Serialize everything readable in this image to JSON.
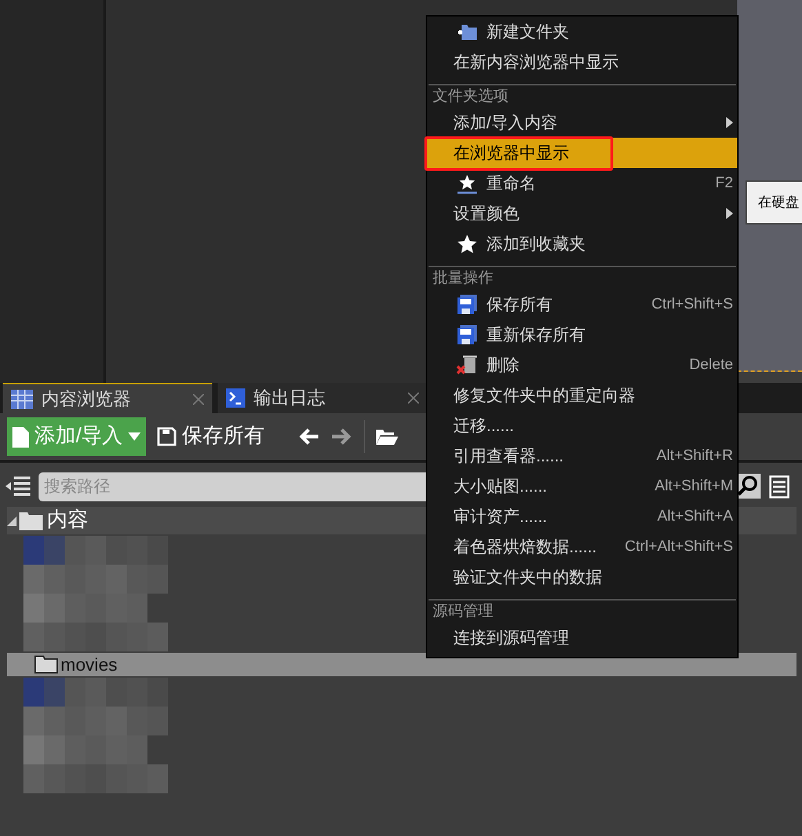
{
  "panel_tabs": [
    {
      "label": "内容浏览器",
      "selected": true
    },
    {
      "label": "输出日志",
      "selected": false
    }
  ],
  "toolbar": {
    "add_button": "添加/导入",
    "save_button": "保存所有"
  },
  "search": {
    "placeholder": "搜索路径"
  },
  "tree": [
    {
      "label": "内容",
      "kind": "root"
    },
    {
      "kind": "blurred"
    },
    {
      "label": "movies",
      "kind": "folder",
      "selected": true
    },
    {
      "kind": "blurred"
    }
  ],
  "context_menu": [
    {
      "kind": "item",
      "label": "新建文件夹",
      "selected": false,
      "outlined": false,
      "submenu": false
    },
    {
      "kind": "item",
      "label": "在新内容浏览器中显示",
      "selected": false,
      "outlined": false,
      "submenu": false
    },
    {
      "kind": "header",
      "label": "文件夹选项"
    },
    {
      "kind": "item",
      "label": "添加/导入内容",
      "selected": false,
      "outlined": false,
      "submenu": true
    },
    {
      "kind": "item",
      "label": "在浏览器中显示",
      "selected": true,
      "outlined": true,
      "submenu": false
    },
    {
      "kind": "item",
      "label": "重命名",
      "shortcut": "F2",
      "selected": false,
      "outlined": false,
      "submenu": false
    },
    {
      "kind": "item",
      "label": "设置颜色",
      "selected": false,
      "outlined": false,
      "submenu": true
    },
    {
      "kind": "item",
      "label": "添加到收藏夹",
      "selected": false,
      "outlined": false,
      "submenu": false
    },
    {
      "kind": "header",
      "label": "批量操作"
    },
    {
      "kind": "item",
      "label": "保存所有",
      "shortcut": "Ctrl+Shift+S",
      "selected": false,
      "outlined": false,
      "submenu": false
    },
    {
      "kind": "item",
      "label": "重新保存所有",
      "selected": false,
      "outlined": false,
      "submenu": false
    },
    {
      "kind": "item",
      "label": "删除",
      "shortcut": "Delete",
      "selected": false,
      "outlined": false,
      "submenu": false
    },
    {
      "kind": "item",
      "label": "修复文件夹中的重定向器",
      "selected": false,
      "outlined": false,
      "submenu": false
    },
    {
      "kind": "item",
      "label": "迁移......",
      "selected": false,
      "outlined": false,
      "submenu": false
    },
    {
      "kind": "item",
      "label": "引用查看器......",
      "shortcut": "Alt+Shift+R",
      "selected": false,
      "outlined": false,
      "submenu": false
    },
    {
      "kind": "item",
      "label": "大小贴图......",
      "shortcut": "Alt+Shift+M",
      "selected": false,
      "outlined": false,
      "submenu": false
    },
    {
      "kind": "item",
      "label": "审计资产......",
      "shortcut": "Alt+Shift+A",
      "selected": false,
      "outlined": false,
      "submenu": false
    },
    {
      "kind": "item",
      "label": "着色器烘焙数据......",
      "shortcut": "Ctrl+Alt+Shift+S",
      "selected": false,
      "outlined": false,
      "submenu": false
    },
    {
      "kind": "item",
      "label": "验证文件夹中的数据",
      "selected": false,
      "outlined": false,
      "submenu": false
    },
    {
      "kind": "header",
      "label": "源码管理"
    },
    {
      "kind": "item",
      "label": "连接到源码管理",
      "selected": false,
      "outlined": false,
      "submenu": false
    }
  ],
  "tooltip": "在硬盘"
}
